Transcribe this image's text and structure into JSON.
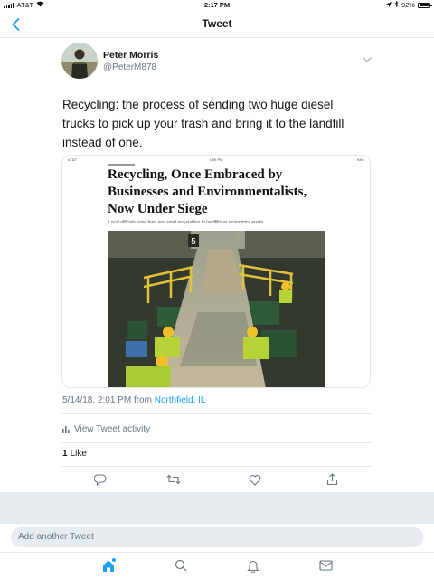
{
  "status_bar": {
    "carrier": "AT&T",
    "time": "2:17 PM",
    "battery": "92%",
    "battery_level": 0.92
  },
  "nav": {
    "title": "Tweet"
  },
  "tweet": {
    "author_name": "Peter Morris",
    "author_handle": "@PeterM878",
    "text": "Recycling: the process of sending two huge diesel trucks to pick up your trash and bring it to the landfill instead of one.",
    "timestamp": "5/14/18, 2:01 PM from",
    "location": "Northfield, IL",
    "activity_label": "View Tweet activity",
    "likes_count": "1",
    "likes_label": "Like"
  },
  "media": {
    "inner_status_left": "AT&T",
    "inner_time": "1:59 PM",
    "inner_battery": "94%",
    "headline": "Recycling, Once Embraced by Businesses and Environmentalists, Now Under Siege",
    "subhead": "Local officials raise fees and send recyclables to landfills as economics erode",
    "photo_sign": "5"
  },
  "compose": {
    "placeholder": "Add another Tweet"
  },
  "colors": {
    "accent": "#1da1f2",
    "text": "#14171a",
    "secondary": "#657786",
    "divider": "#e1e8ed",
    "background_gray": "#e6ecf0"
  }
}
